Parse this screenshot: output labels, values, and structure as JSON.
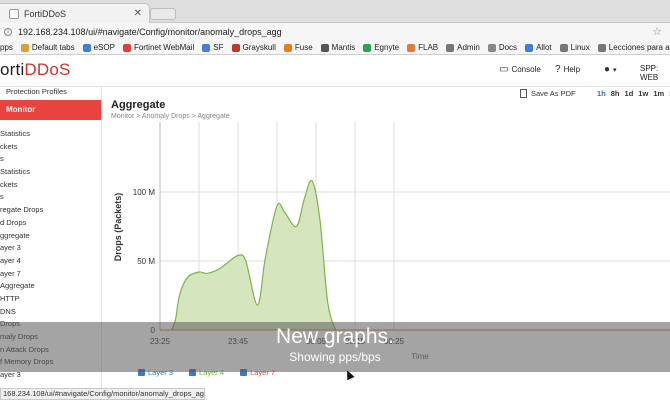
{
  "browser": {
    "tab_title": "FortiDDoS",
    "url": "192.168.234.108/ui/#navigate/Config/monitor/anomaly_drops_agg",
    "bookmarks": [
      "pps",
      "Default tabs",
      "eSOP",
      "Fortinet WebMail",
      "SF",
      "Grayskull",
      "Fuse",
      "Mantis",
      "Egnyte",
      "FLAB",
      "Admin",
      "Docs",
      "Allot",
      "Linux",
      "Lecciones para apr…"
    ],
    "status_url": "168.234.108/ui/#navigate/Config/monitor/anomaly_drops_agg"
  },
  "app": {
    "logo_prefix": "orti",
    "logo_suffix": "DDoS",
    "console_label": "Console",
    "help_label": "Help",
    "spp_label": "SPP: WEB"
  },
  "sidebar": {
    "top_label": "Protection Profiles",
    "active_label": "Monitor",
    "items": [
      "Statistics",
      "ckets",
      "s",
      "Statistics",
      "ckets",
      "s",
      "regate Drops",
      "d Drops",
      "ggregate",
      "ayer 3",
      "ayer 4",
      "ayer 7",
      "Aggregate",
      "HTTP",
      "DNS",
      "Drops",
      "maly Drops",
      "n Attack Drops",
      "f Memory Drops",
      "ayer 3"
    ]
  },
  "main": {
    "title": "Aggregate",
    "breadcrumb": "Monitor   >   Anomaly Drops   >   Aggregate",
    "save_pdf": "Save As PDF",
    "ranges": [
      "1h",
      "8h",
      "1d",
      "1w",
      "1m",
      "1y"
    ],
    "active_range": "1h"
  },
  "chart_data": {
    "type": "area",
    "ylabel": "Drops (Packets)",
    "xlabel": "Time",
    "x_ticks": [
      "23:25",
      "23:45",
      "00:05",
      "00:15",
      "00:25"
    ],
    "y_ticks": [
      "0",
      "50 M",
      "100 M"
    ],
    "ylim": [
      0,
      140
    ],
    "x": [
      "23:28",
      "23:29",
      "23:30",
      "23:32",
      "23:35",
      "23:37",
      "23:40",
      "23:42",
      "23:45",
      "23:47",
      "23:50",
      "23:52",
      "23:55",
      "23:57",
      "00:00",
      "00:02",
      "00:04",
      "00:06",
      "00:08",
      "00:10"
    ],
    "values": [
      0,
      8,
      25,
      38,
      42,
      41,
      44,
      48,
      54,
      50,
      18,
      52,
      90,
      85,
      75,
      95,
      108,
      80,
      20,
      0
    ],
    "series": [
      {
        "name": "Layer 3",
        "color": "#3d79c4"
      },
      {
        "name": "Layer 4",
        "color": "#6fb040"
      },
      {
        "name": "Layer 7",
        "color": "#d9534f"
      }
    ],
    "area_fill": "#d5e6bf",
    "area_line": "#7cb44a",
    "grid": true
  },
  "caption": {
    "title": "New graphs.",
    "subtitle": "Showing pps/bps"
  }
}
